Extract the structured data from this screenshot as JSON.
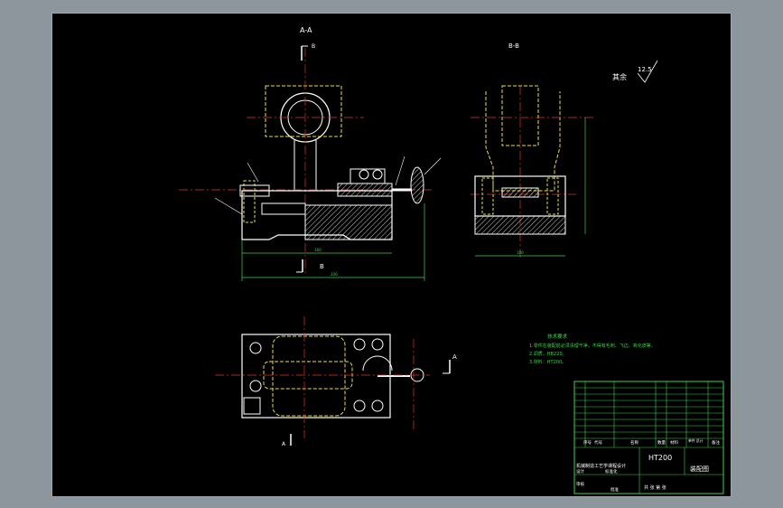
{
  "drawing": {
    "section_aa": "A-A",
    "section_bb": "B-B",
    "cut_label_b": "B",
    "cut_label_a": "A",
    "roughness_prefix": "其余",
    "roughness_value": "12.5",
    "tech_req": {
      "title": "技术要求",
      "items": [
        "1.零件在装配前必须清理干净，不得有毛刺、飞边、氧化皮等。",
        "2.调质，HB220。",
        "3.材料：HT200。"
      ]
    },
    "title_block": {
      "material": "HT200",
      "drawing_name": "装配图",
      "company": "机械制造工艺学课程设计",
      "checker_label": "审核",
      "designer_label": "设计",
      "standard_label": "标准化",
      "approve_label": "批准",
      "scale_row": "共  张  第  张",
      "col_item": "序号",
      "col_code": "代号",
      "col_name": "名称",
      "col_qty": "数量",
      "col_material": "材料",
      "col_weight": "单件 总计",
      "col_note": "备注"
    }
  },
  "colors": {
    "line": "#ffffff",
    "hidden": "#e8e03a",
    "center": "#e03030",
    "dim": "#3fd24a",
    "hatch": "#ffffff"
  }
}
